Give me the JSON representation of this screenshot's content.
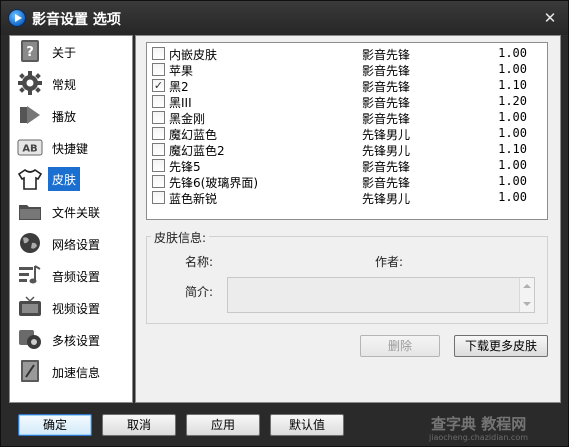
{
  "window": {
    "title": "影音设置 选项",
    "close_glyph": "✕"
  },
  "sidebar": {
    "items": [
      {
        "label": "关于",
        "icon": "question-icon"
      },
      {
        "label": "常规",
        "icon": "gear-icon"
      },
      {
        "label": "播放",
        "icon": "play-icon"
      },
      {
        "label": "快捷键",
        "icon": "keyboard-ab-icon"
      },
      {
        "label": "皮肤",
        "icon": "tshirt-icon",
        "active": true
      },
      {
        "label": "文件关联",
        "icon": "folder-icon"
      },
      {
        "label": "网络设置",
        "icon": "globe-icon"
      },
      {
        "label": "音频设置",
        "icon": "audio-icon"
      },
      {
        "label": "视频设置",
        "icon": "tv-icon"
      },
      {
        "label": "多核设置",
        "icon": "cpu-gear-icon"
      },
      {
        "label": "加速信息",
        "icon": "speed-icon"
      }
    ]
  },
  "skins": [
    {
      "name": "内嵌皮肤",
      "author": "影音先锋",
      "version": "1.00",
      "checked": false
    },
    {
      "name": "苹果",
      "author": "影音先锋",
      "version": "1.00",
      "checked": false
    },
    {
      "name": "黑2",
      "author": "影音先锋",
      "version": "1.10",
      "checked": true
    },
    {
      "name": "黑III",
      "author": "影音先锋",
      "version": "1.20",
      "checked": false
    },
    {
      "name": "黑金刚",
      "author": "影音先锋",
      "version": "1.00",
      "checked": false
    },
    {
      "name": "魔幻蓝色",
      "author": "先锋男儿",
      "version": "1.00",
      "checked": false
    },
    {
      "name": "魔幻蓝色2",
      "author": "先锋男儿",
      "version": "1.10",
      "checked": false
    },
    {
      "name": "先锋5",
      "author": "影音先锋",
      "version": "1.00",
      "checked": false
    },
    {
      "name": "先锋6(玻璃界面)",
      "author": "影音先锋",
      "version": "1.00",
      "checked": false
    },
    {
      "name": "蓝色新锐",
      "author": "先锋男儿",
      "version": "1.00",
      "checked": false
    }
  ],
  "skin_info": {
    "group_title": "皮肤信息:",
    "name_label": "名称:",
    "author_label": "作者:",
    "desc_label": "简介:",
    "name_value": "",
    "author_value": "",
    "desc_value": ""
  },
  "buttons": {
    "delete": "删除",
    "download_more": "下载更多皮肤",
    "ok": "确定",
    "cancel": "取消",
    "apply": "应用",
    "default": "默认值"
  },
  "watermark": {
    "text": "查字典 教程网",
    "sub": "jiaocheng.chazidian.com"
  },
  "colors": {
    "accent": "#1a6fd0",
    "titlebar": "#2e2e2e"
  }
}
